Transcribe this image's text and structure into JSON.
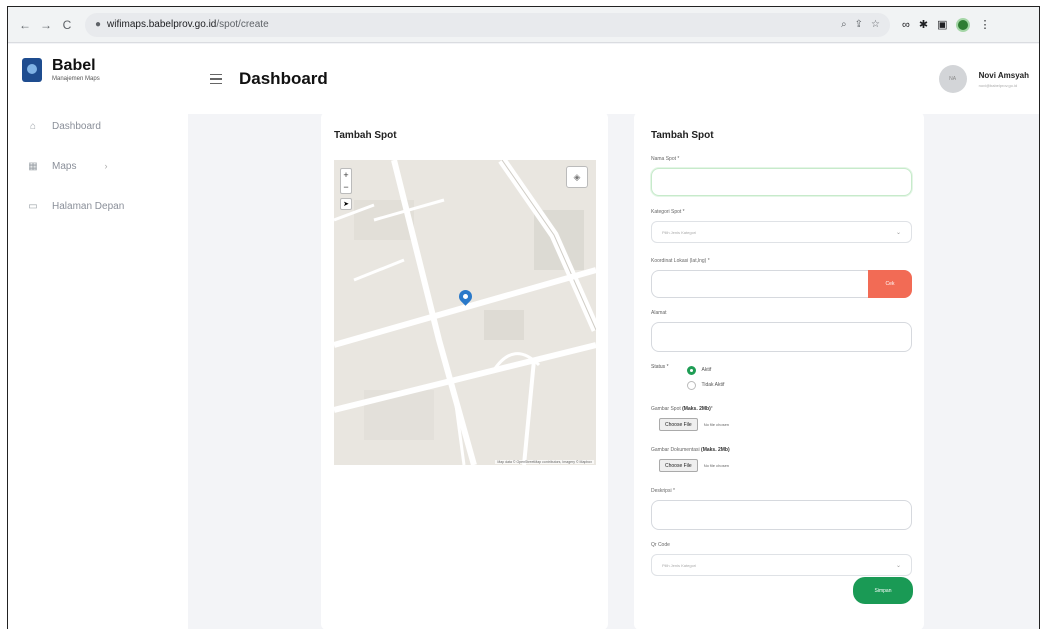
{
  "browser": {
    "url_host": "wifimaps.babelprov.go.id",
    "url_path": "/spot/create",
    "nav_back": "←",
    "nav_forward": "→",
    "nav_reload": "C"
  },
  "sidebar": {
    "brand_title": "Babel",
    "brand_subtitle": "Manajemen Maps",
    "items": [
      {
        "label": "Dashboard",
        "icon": "home-icon"
      },
      {
        "label": "Maps",
        "icon": "map-icon"
      },
      {
        "label": "Halaman Depan",
        "icon": "monitor-icon"
      }
    ]
  },
  "topbar": {
    "title": "Dashboard",
    "user_name": "Novi Amsyah",
    "user_email": "novi@babelprov.go.id",
    "avatar_text": "NA"
  },
  "map_card": {
    "title": "Tambah Spot",
    "zoom_in": "+",
    "zoom_out": "−",
    "attribution": "Map data © OpenStreetMap contributors, Imagery © Mapbox"
  },
  "form": {
    "title": "Tambah Spot",
    "nama_label": "Nama Spot *",
    "kategori_label": "Kategori Spot *",
    "kategori_placeholder": "Pilih Jenis Kategori",
    "koordinat_label": "Koordinat Lokasi (lat,lng) *",
    "cek_label": "Cek",
    "alamat_label": "Alamat",
    "status_label": "Status *",
    "status_options": [
      "Aktif",
      "Tidak Aktif"
    ],
    "status_selected": "Aktif",
    "gambar_label_pre": "Gambar Spot ",
    "gambar_label_bold": "(Maks. 2Mb)",
    "gambar_label_post": "*",
    "dokumentasi_label_pre": "Gambar Dokumentasi ",
    "dokumentasi_label_bold": "(Maks. 2Mb)",
    "choose_file": "Choose File",
    "no_file": "No file chosen",
    "deskripsi_label": "Deskripsi *",
    "qr_label": "Qr Code",
    "qr_placeholder": "Pilih Jenis Kategori",
    "submit_label": "Simpan"
  },
  "colors": {
    "primary_green": "#1a9a55",
    "cek_red": "#f26b55",
    "pin_blue": "#2a79c9"
  }
}
